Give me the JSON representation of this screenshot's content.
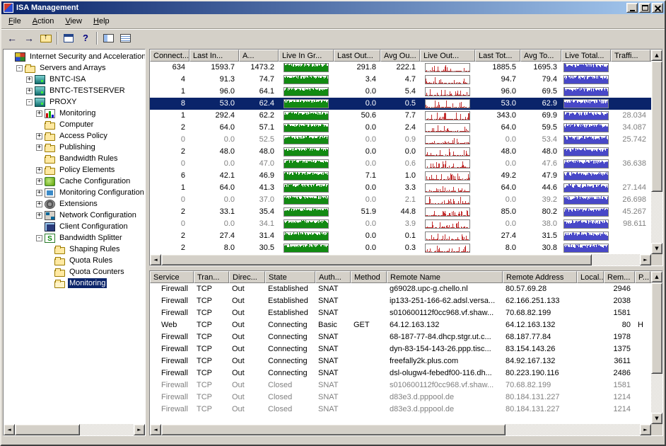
{
  "window": {
    "title": "ISA Management",
    "controls": [
      "minimize-icon",
      "maximize-icon",
      "close-icon"
    ]
  },
  "menu_bar": {
    "items": [
      "File",
      "Action",
      "View",
      "Help"
    ]
  },
  "toolbar": {
    "buttons": [
      {
        "icon": "back-icon"
      },
      {
        "icon": "forward-icon"
      },
      {
        "icon": "up-folder-icon"
      },
      {
        "icon": "separator"
      },
      {
        "icon": "properties-icon"
      },
      {
        "icon": "help-icon"
      },
      {
        "icon": "separator"
      },
      {
        "icon": "show-tree-icon"
      },
      {
        "icon": "export-list-icon"
      }
    ]
  },
  "tree": {
    "items": [
      {
        "label": "Internet Security and Acceleration Se",
        "level": 0,
        "expand": "",
        "icon": "console-root",
        "selected": false
      },
      {
        "label": "Servers and Arrays",
        "level": 1,
        "expand": "-",
        "icon": "servers-folder",
        "selected": false
      },
      {
        "label": "BNTC-ISA",
        "level": 2,
        "expand": "+",
        "icon": "server",
        "selected": false
      },
      {
        "label": "BNTC-TESTSERVER",
        "level": 2,
        "expand": "+",
        "icon": "server",
        "selected": false
      },
      {
        "label": "PROXY",
        "level": 2,
        "expand": "-",
        "icon": "server",
        "selected": false
      },
      {
        "label": "Monitoring",
        "level": 3,
        "expand": "+",
        "icon": "monitoring",
        "selected": false
      },
      {
        "label": "Computer",
        "level": 3,
        "expand": "",
        "icon": "folder",
        "selected": false
      },
      {
        "label": "Access Policy",
        "level": 3,
        "expand": "+",
        "icon": "folder",
        "selected": false
      },
      {
        "label": "Publishing",
        "level": 3,
        "expand": "+",
        "icon": "folder",
        "selected": false
      },
      {
        "label": "Bandwidth Rules",
        "level": 3,
        "expand": "",
        "icon": "folder",
        "selected": false
      },
      {
        "label": "Policy Elements",
        "level": 3,
        "expand": "+",
        "icon": "folder",
        "selected": false
      },
      {
        "label": "Cache Configuration",
        "level": 3,
        "expand": "+",
        "icon": "cache",
        "selected": false
      },
      {
        "label": "Monitoring Configuration",
        "level": 3,
        "expand": "+",
        "icon": "monitoring-config",
        "selected": false
      },
      {
        "label": "Extensions",
        "level": 3,
        "expand": "+",
        "icon": "extensions",
        "selected": false
      },
      {
        "label": "Network Configuration",
        "level": 3,
        "expand": "+",
        "icon": "network",
        "selected": false
      },
      {
        "label": "Client Configuration",
        "level": 3,
        "expand": "",
        "icon": "client",
        "selected": false
      },
      {
        "label": "Bandwidth Splitter",
        "level": 3,
        "expand": "-",
        "icon": "splitter",
        "selected": false
      },
      {
        "label": "Shaping Rules",
        "level": 4,
        "expand": "",
        "icon": "folder",
        "selected": false
      },
      {
        "label": "Quota Rules",
        "level": 4,
        "expand": "",
        "icon": "folder",
        "selected": false
      },
      {
        "label": "Quota Counters",
        "level": 4,
        "expand": "",
        "icon": "folder",
        "selected": false
      },
      {
        "label": "Monitoring",
        "level": 4,
        "expand": "",
        "icon": "folder-open",
        "selected": true
      }
    ]
  },
  "top_table": {
    "columns": [
      "Connect...",
      "Last In...",
      "A...",
      "Live In Gr...",
      "Last Out...",
      "Avg Ou...",
      "Live Out...",
      "Last Tot...",
      "Avg To...",
      "Live Total...",
      "Traffi..."
    ],
    "chart_colors": {
      "in": "#128a12",
      "out": "#c43030",
      "total": "#4848c8"
    },
    "rows": [
      {
        "values": [
          "634",
          "1593.7",
          "1473.2",
          "291.8",
          "222.1",
          "1885.5",
          "1695.3",
          ""
        ],
        "dim": false,
        "selected": false
      },
      {
        "values": [
          "4",
          "91.3",
          "74.7",
          "3.4",
          "4.7",
          "94.7",
          "79.4",
          ""
        ],
        "dim": false,
        "selected": false
      },
      {
        "values": [
          "1",
          "96.0",
          "64.1",
          "0.0",
          "5.4",
          "96.0",
          "69.5",
          ""
        ],
        "dim": false,
        "selected": false
      },
      {
        "values": [
          "8",
          "53.0",
          "62.4",
          "0.0",
          "0.5",
          "53.0",
          "62.9",
          ""
        ],
        "dim": false,
        "selected": true
      },
      {
        "values": [
          "1",
          "292.4",
          "62.2",
          "50.6",
          "7.7",
          "343.0",
          "69.9",
          "28.034"
        ],
        "dim": false,
        "selected": false
      },
      {
        "values": [
          "2",
          "64.0",
          "57.1",
          "0.0",
          "2.4",
          "64.0",
          "59.5",
          "34.087"
        ],
        "dim": false,
        "selected": false
      },
      {
        "values": [
          "0",
          "0.0",
          "52.5",
          "0.0",
          "0.9",
          "0.0",
          "53.4",
          "25.742"
        ],
        "dim": true,
        "selected": false
      },
      {
        "values": [
          "2",
          "48.0",
          "48.0",
          "0.0",
          "0.0",
          "48.0",
          "48.0",
          ""
        ],
        "dim": false,
        "selected": false
      },
      {
        "values": [
          "0",
          "0.0",
          "47.0",
          "0.0",
          "0.6",
          "0.0",
          "47.6",
          "36.638"
        ],
        "dim": true,
        "selected": false
      },
      {
        "values": [
          "6",
          "42.1",
          "46.9",
          "7.1",
          "1.0",
          "49.2",
          "47.9",
          ""
        ],
        "dim": false,
        "selected": false
      },
      {
        "values": [
          "1",
          "64.0",
          "41.3",
          "0.0",
          "3.3",
          "64.0",
          "44.6",
          "27.144"
        ],
        "dim": false,
        "selected": false
      },
      {
        "values": [
          "0",
          "0.0",
          "37.0",
          "0.0",
          "2.1",
          "0.0",
          "39.2",
          "26.698"
        ],
        "dim": true,
        "selected": false
      },
      {
        "values": [
          "2",
          "33.1",
          "35.4",
          "51.9",
          "44.8",
          "85.0",
          "80.2",
          "45.267"
        ],
        "dim": false,
        "selected": false
      },
      {
        "values": [
          "0",
          "0.0",
          "34.1",
          "0.0",
          "3.9",
          "0.0",
          "38.0",
          "98.611"
        ],
        "dim": true,
        "selected": false
      },
      {
        "values": [
          "2",
          "27.4",
          "31.4",
          "0.0",
          "0.1",
          "27.4",
          "31.5",
          ""
        ],
        "dim": false,
        "selected": false
      },
      {
        "values": [
          "2",
          "8.0",
          "30.5",
          "0.0",
          "0.3",
          "8.0",
          "30.8",
          ""
        ],
        "dim": false,
        "selected": false
      }
    ]
  },
  "bottom_table": {
    "columns": [
      "Service",
      "Tran...",
      "Direc...",
      "State",
      "Auth...",
      "Method",
      "Remote Name",
      "Remote Address",
      "Local...",
      "Rem...",
      "P..."
    ],
    "rows": [
      {
        "values": [
          "Firewall",
          "TCP",
          "Out",
          "Established",
          "SNAT",
          "",
          "g69028.upc-g.chello.nl",
          "80.57.69.28",
          "",
          "2946",
          ""
        ],
        "dim": false
      },
      {
        "values": [
          "Firewall",
          "TCP",
          "Out",
          "Established",
          "SNAT",
          "",
          "ip133-251-166-62.adsl.versa...",
          "62.166.251.133",
          "",
          "2038",
          ""
        ],
        "dim": false
      },
      {
        "values": [
          "Firewall",
          "TCP",
          "Out",
          "Established",
          "SNAT",
          "",
          "s010600112f0cc968.vf.shaw...",
          "70.68.82.199",
          "",
          "1581",
          ""
        ],
        "dim": false
      },
      {
        "values": [
          "Web",
          "TCP",
          "Out",
          "Connecting",
          "Basic",
          "GET",
          "64.12.163.132",
          "64.12.163.132",
          "",
          "80",
          "H"
        ],
        "dim": false
      },
      {
        "values": [
          "Firewall",
          "TCP",
          "Out",
          "Connecting",
          "SNAT",
          "",
          "68-187-77-84.dhcp.stgr.ut.c...",
          "68.187.77.84",
          "",
          "1978",
          ""
        ],
        "dim": false
      },
      {
        "values": [
          "Firewall",
          "TCP",
          "Out",
          "Connecting",
          "SNAT",
          "",
          "dyn-83-154-143-26.ppp.tisc...",
          "83.154.143.26",
          "",
          "1375",
          ""
        ],
        "dim": false
      },
      {
        "values": [
          "Firewall",
          "TCP",
          "Out",
          "Connecting",
          "SNAT",
          "",
          "freefally2k.plus.com",
          "84.92.167.132",
          "",
          "3611",
          ""
        ],
        "dim": false
      },
      {
        "values": [
          "Firewall",
          "TCP",
          "Out",
          "Connecting",
          "SNAT",
          "",
          "dsl-olugw4-febedf00-116.dh...",
          "80.223.190.116",
          "",
          "2486",
          ""
        ],
        "dim": false
      },
      {
        "values": [
          "Firewall",
          "TCP",
          "Out",
          "Closed",
          "SNAT",
          "",
          "s010600112f0cc968.vf.shaw...",
          "70.68.82.199",
          "",
          "1581",
          ""
        ],
        "dim": true
      },
      {
        "values": [
          "Firewall",
          "TCP",
          "Out",
          "Closed",
          "SNAT",
          "",
          "d83e3.d.pppool.de",
          "80.184.131.227",
          "",
          "1214",
          ""
        ],
        "dim": true
      },
      {
        "values": [
          "Firewall",
          "TCP",
          "Out",
          "Closed",
          "SNAT",
          "",
          "d83e3.d.pppool.de",
          "80.184.131.227",
          "",
          "1214",
          ""
        ],
        "dim": true
      }
    ]
  }
}
